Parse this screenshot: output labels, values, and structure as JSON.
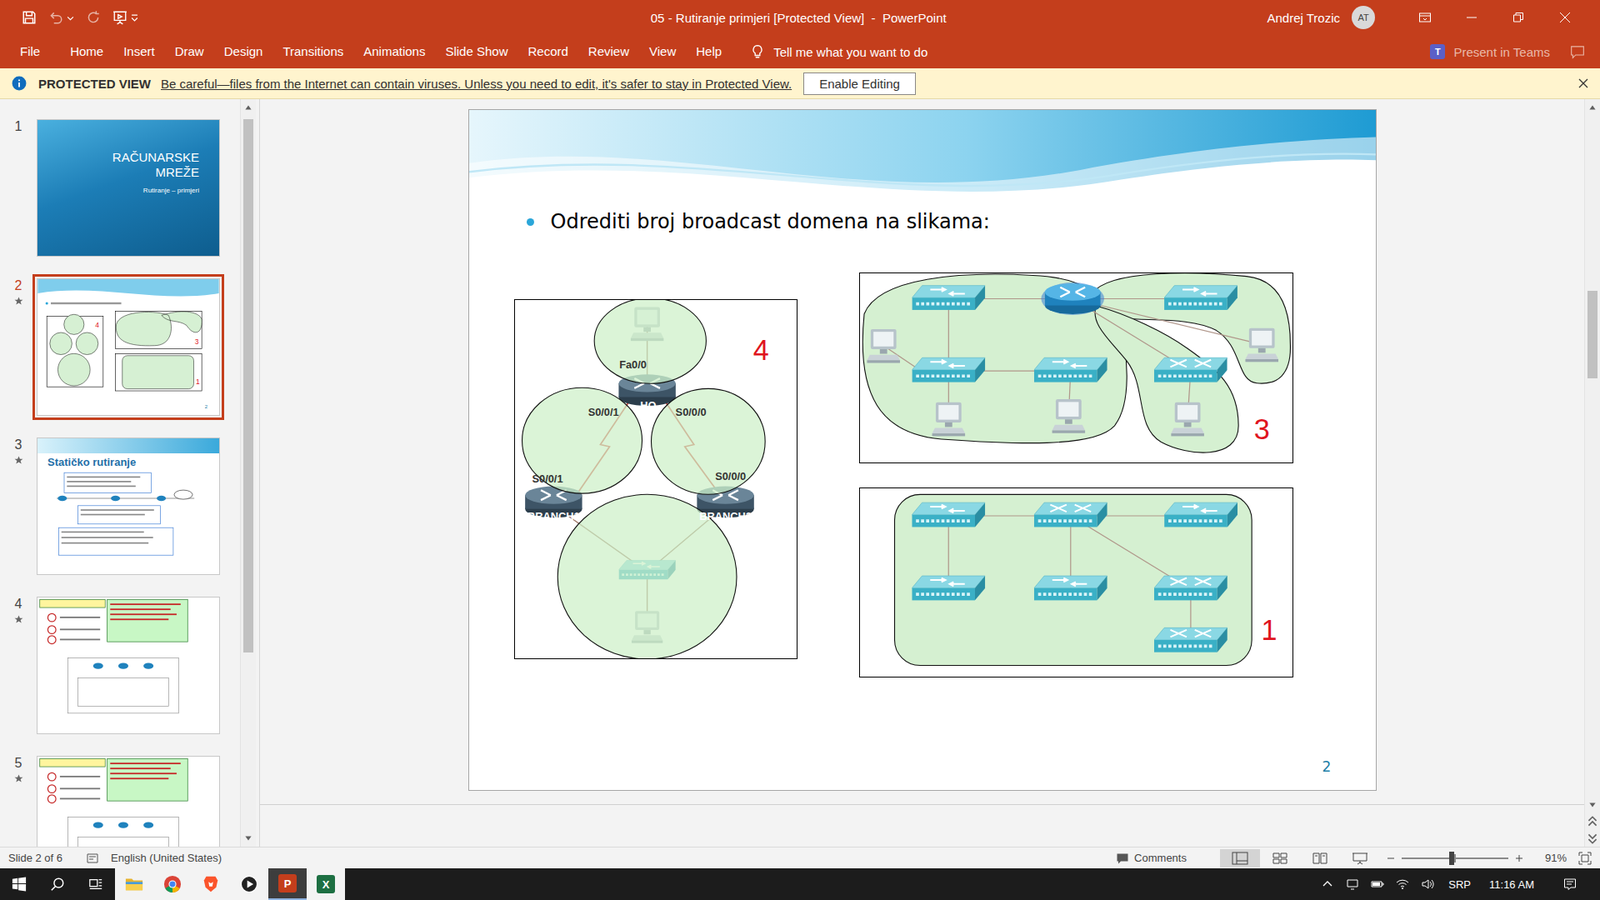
{
  "window": {
    "title": "05 - Rutiranje primjeri [Protected View]  -  PowerPoint",
    "user": "Andrej Trozic",
    "avatar": "AT"
  },
  "ribbon": {
    "tabs": [
      {
        "label": "File",
        "selected": false
      },
      {
        "label": "Home",
        "selected": false
      },
      {
        "label": "Insert",
        "selected": false
      },
      {
        "label": "Draw",
        "selected": false
      },
      {
        "label": "Design",
        "selected": false
      },
      {
        "label": "Transitions",
        "selected": false
      },
      {
        "label": "Animations",
        "selected": false
      },
      {
        "label": "Slide Show",
        "selected": false
      },
      {
        "label": "Record",
        "selected": false
      },
      {
        "label": "Review",
        "selected": false
      },
      {
        "label": "View",
        "selected": false
      },
      {
        "label": "Help",
        "selected": false
      }
    ],
    "tell_me": "Tell me what you want to do",
    "present": {
      "label": "Present in Teams",
      "glyph": "T",
      "disabled": true
    }
  },
  "protected_view": {
    "label": "PROTECTED VIEW",
    "message": "Be careful—files from the Internet can contain viruses. Unless you need to edit, it's safer to stay in Protected View.",
    "button": "Enable Editing"
  },
  "thumbnails": [
    {
      "number": "1",
      "starred": false,
      "selected": false,
      "kind": "title",
      "title": "RAČUNARSKE MREŽE",
      "subtitle": "Rutiranje – primjeri"
    },
    {
      "number": "2",
      "starred": true,
      "selected": true,
      "kind": "diagram"
    },
    {
      "number": "3",
      "starred": true,
      "selected": false,
      "kind": "static",
      "title": "Statičko rutiranje"
    },
    {
      "number": "4",
      "starred": true,
      "selected": false,
      "kind": "notes"
    },
    {
      "number": "5",
      "starred": true,
      "selected": false,
      "kind": "notes"
    }
  ],
  "slide": {
    "bullet": "Odrediti broj broadcast domena na slikama:",
    "page": "2",
    "diagrams": [
      {
        "kind": "wan",
        "count": "4",
        "labels": [
          "Fa0/0",
          "HQ",
          "S0/0/1",
          "S0/0/0",
          "S0/0/1",
          "S0/0/0",
          "BRANCH1",
          "BRANCH2"
        ]
      },
      {
        "kind": "routed",
        "count": "3",
        "labels": []
      },
      {
        "kind": "switched",
        "count": "1",
        "labels": []
      }
    ]
  },
  "status_bar": {
    "slide": "Slide 2 of 6",
    "language": "English (United States)",
    "comments": "Comments",
    "zoom": "91%",
    "zoom_level": 0.47
  },
  "taskbar": {
    "apps": [
      {
        "kind": "explorer",
        "glyph": "",
        "selected": false
      },
      {
        "kind": "chrome",
        "glyph": "",
        "selected": false
      },
      {
        "kind": "brave",
        "glyph": "",
        "selected": false
      },
      {
        "kind": "media",
        "glyph": "",
        "selected": false
      },
      {
        "kind": "powerpoint",
        "glyph": "P",
        "selected": true
      },
      {
        "kind": "excel",
        "glyph": "X",
        "selected": false
      }
    ],
    "language": "SRP",
    "time": "11:16 AM"
  }
}
